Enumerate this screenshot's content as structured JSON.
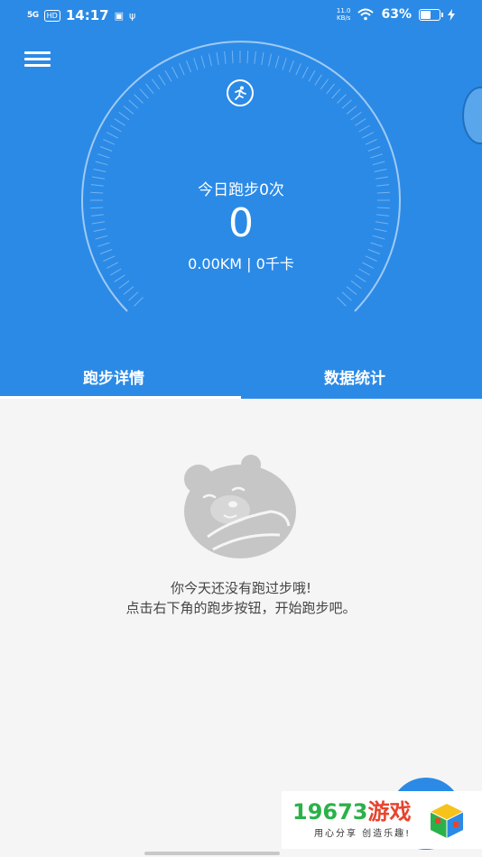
{
  "status_bar": {
    "signal": "5G",
    "hd": "HD",
    "time": "14:17",
    "net_speed_value": "11.0",
    "net_speed_unit": "KB/s",
    "battery_pct": "63%",
    "battery_level": 0.63
  },
  "today": {
    "runs_label": "今日跑步0次",
    "steps": "0",
    "stats": "0.00KM | 0千卡"
  },
  "tabs": [
    {
      "label": "跑步详情",
      "active": true
    },
    {
      "label": "数据统计",
      "active": false
    }
  ],
  "empty_state": {
    "line1": "你今天还没有跑过步哦!",
    "line2": "点击右下角的跑步按钮，开始跑步吧。"
  },
  "watermark": {
    "brand_digits": "19673",
    "brand_cn": "游戏",
    "slogan": "用心分享 创造乐趣!"
  },
  "colors": {
    "primary": "#2b8ae6",
    "background": "#f5f5f5",
    "text": "#444444"
  }
}
